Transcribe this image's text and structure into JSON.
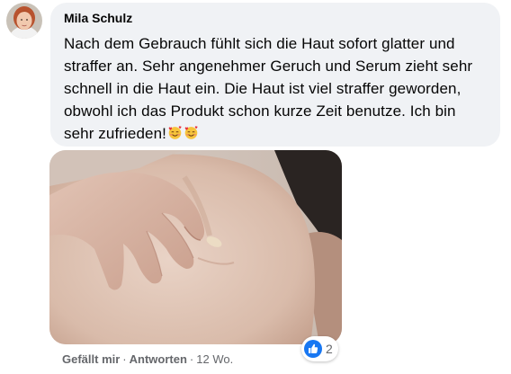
{
  "comment": {
    "author": "Mila Schulz",
    "text": "Nach dem Gebrauch fühlt sich die Haut sofort glatter und straffer an. Sehr angenehmer Geruch und Serum zieht sehr schnell in die Haut ein. Die Haut ist viel straffer geworden, obwohl ich das Produkt schon kurze Zeit benutze. Ich bin sehr zufrieden!",
    "emojis": [
      "smiling-face-with-hearts-emoji",
      "smiling-face-with-hearts-emoji"
    ],
    "avatar_icon": "profile-photo",
    "attached_image": "photo-hand-pinching-thigh-skin"
  },
  "actions": {
    "like_label": "Gefällt mir",
    "reply_label": "Antworten",
    "separator": "·",
    "timestamp": "12 Wo."
  },
  "reactions": {
    "icon": "like-thumbs-up-icon",
    "count": "2"
  },
  "colors": {
    "bubble_bg": "#f0f2f5",
    "text": "#050505",
    "secondary_text": "#65676b",
    "like_blue": "#1877f2"
  }
}
